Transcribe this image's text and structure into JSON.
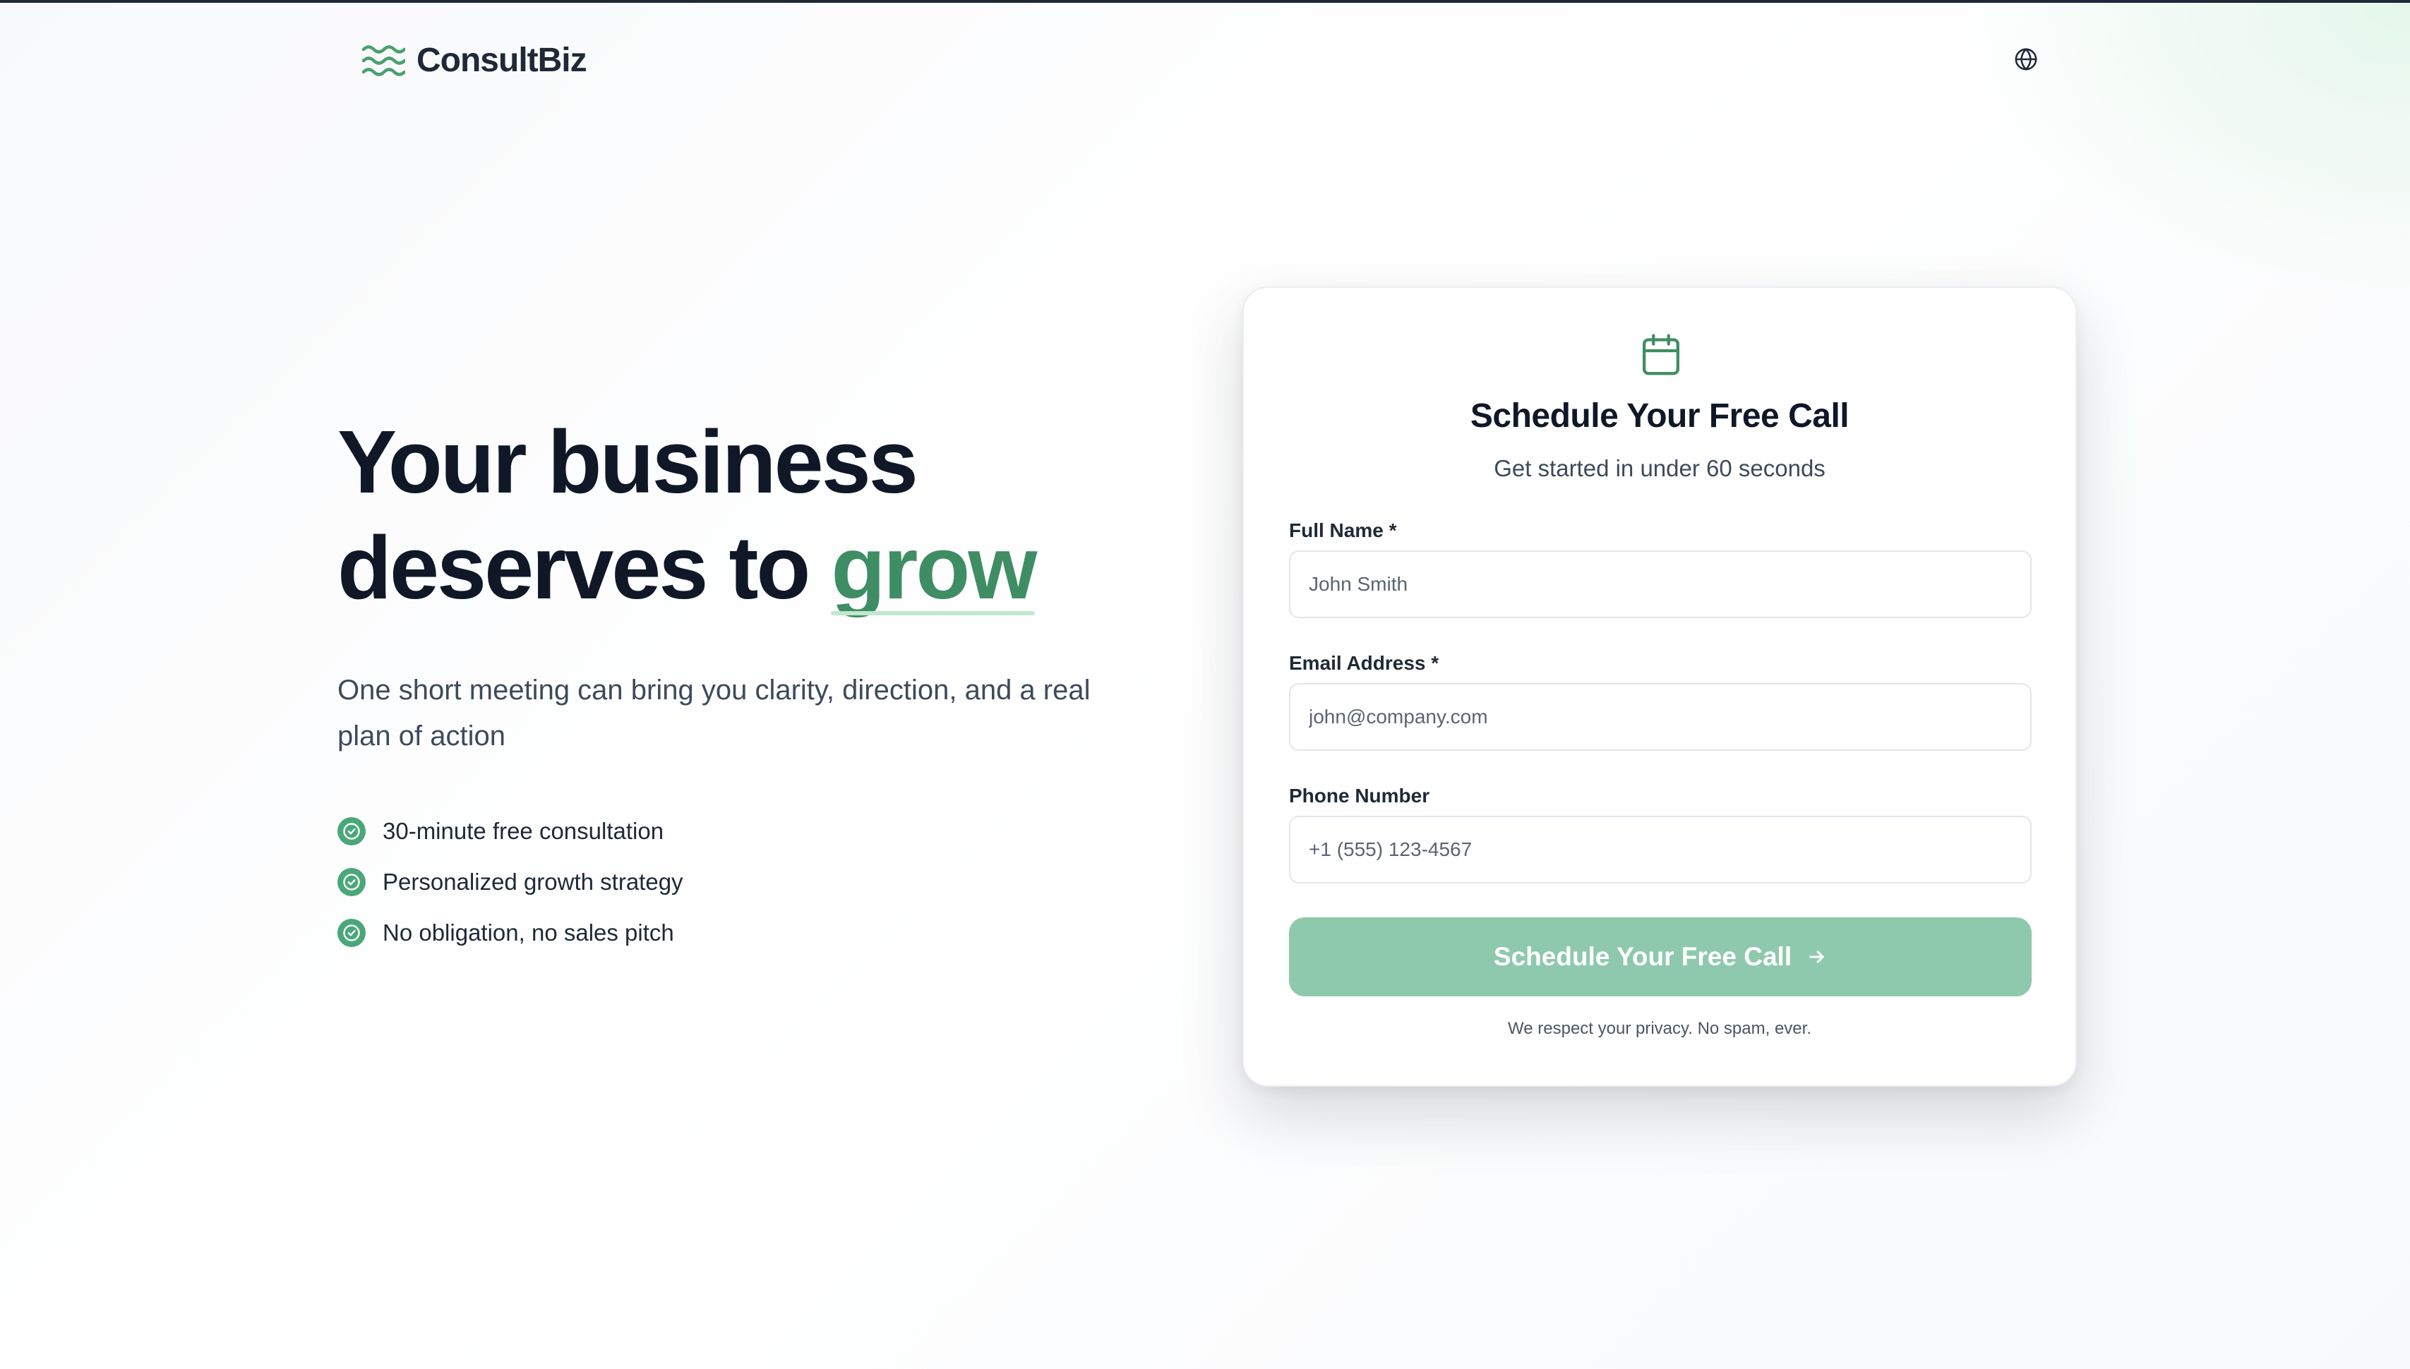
{
  "brand": {
    "name": "ConsultBiz",
    "logo_icon": "waves-icon",
    "accent_color": "#3f8d64"
  },
  "header": {
    "language_icon": "globe-icon"
  },
  "hero": {
    "headline_line1": "Your business",
    "headline_line2_prefix": "deserves to ",
    "headline_highlight": "grow",
    "subtitle": "One short meeting can bring you clarity, direction, and a real plan of action",
    "benefit_icon": "check-circle-icon",
    "benefits": [
      "30-minute free consultation",
      "Personalized growth strategy",
      "No obligation, no sales pitch"
    ]
  },
  "form": {
    "icon": "calendar-icon",
    "title": "Schedule Your Free Call",
    "subtitle": "Get started in under 60 seconds",
    "fields": {
      "full_name": {
        "label": "Full Name *",
        "placeholder": "John Smith",
        "value": ""
      },
      "email": {
        "label": "Email Address *",
        "placeholder": "john@company.com",
        "value": ""
      },
      "phone": {
        "label": "Phone Number",
        "placeholder": "+1 (555) 123-4567",
        "value": ""
      }
    },
    "submit_label": "Schedule Your Free Call",
    "submit_icon": "arrow-right-icon",
    "submit_color": "#8fc9ad",
    "privacy_note": "We respect your privacy. No spam, ever."
  }
}
